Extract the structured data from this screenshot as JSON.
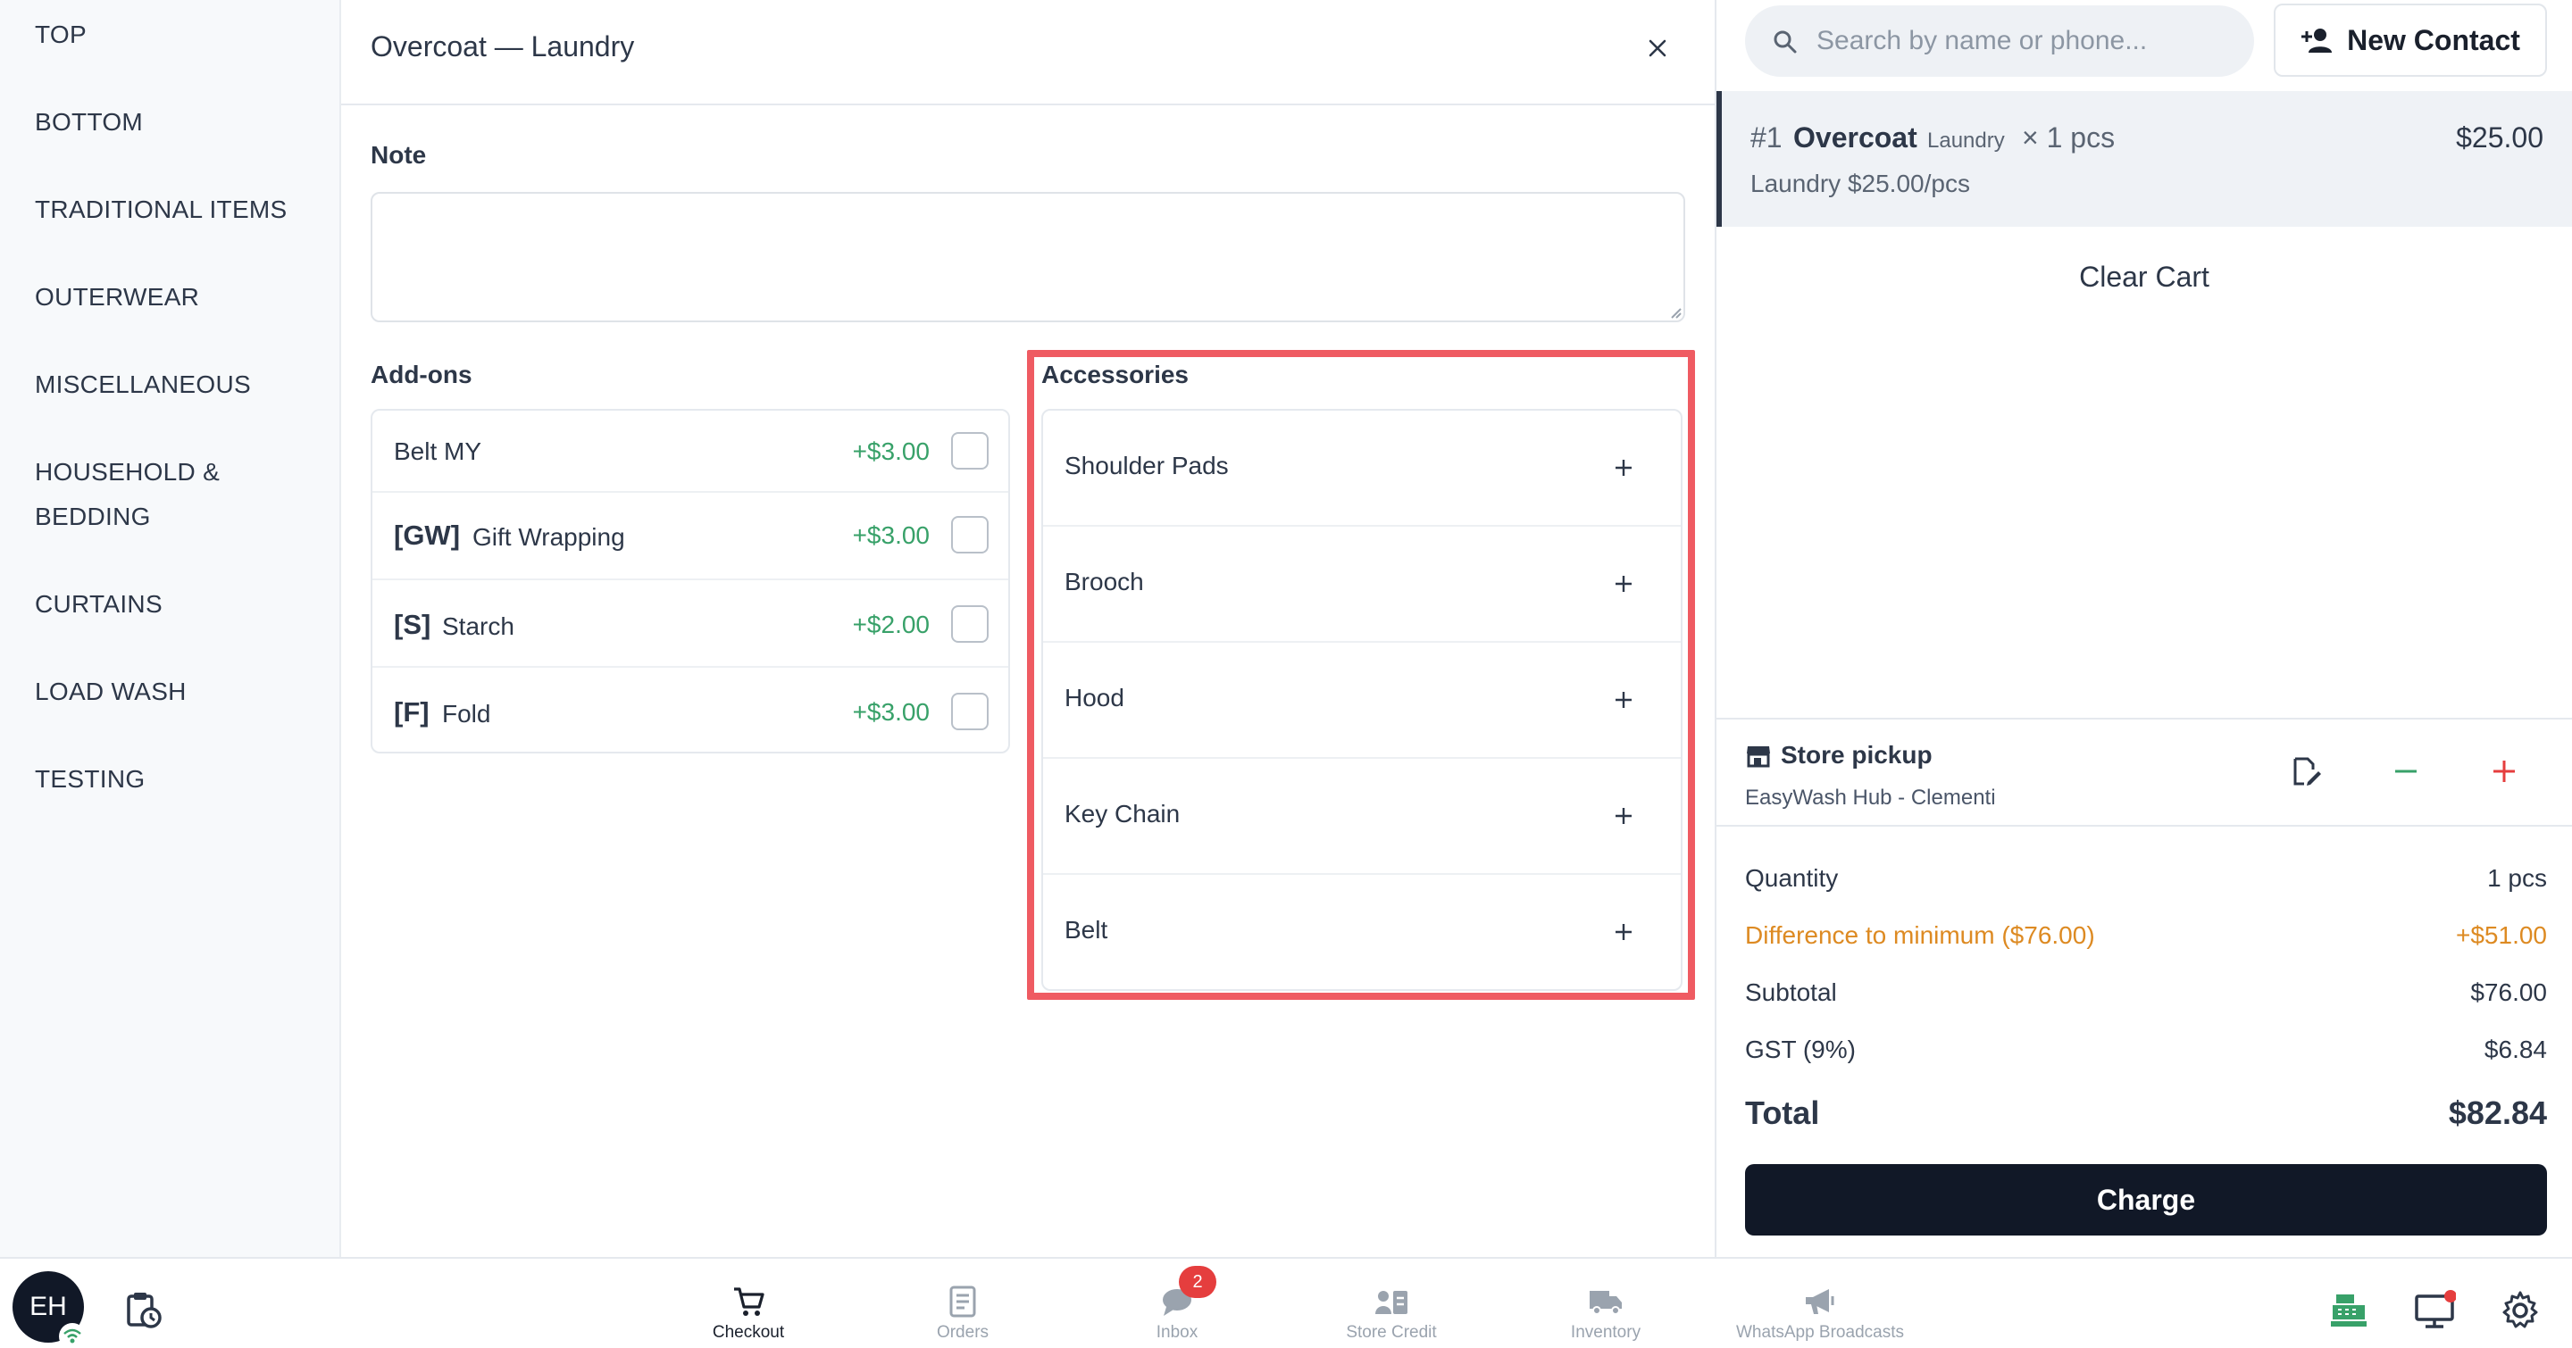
{
  "sidebar": {
    "items": [
      {
        "label": "TOP"
      },
      {
        "label": "BOTTOM"
      },
      {
        "label": "TRADITIONAL ITEMS"
      },
      {
        "label": "OUTERWEAR"
      },
      {
        "label": "MISCELLANEOUS"
      },
      {
        "label": "HOUSEHOLD &"
      },
      {
        "label": "BEDDING"
      },
      {
        "label": "CURTAINS"
      },
      {
        "label": "LOAD WASH"
      },
      {
        "label": "TESTING"
      }
    ]
  },
  "detail": {
    "title": "Overcoat — Laundry",
    "close_icon": "close-icon",
    "note_label": "Note",
    "note_value": "",
    "addons_label": "Add-ons",
    "addons": [
      {
        "code": "",
        "name": "Belt MY",
        "price": "+$3.00",
        "checked": false
      },
      {
        "code": "[GW]",
        "name": "Gift Wrapping",
        "price": "+$3.00",
        "checked": false
      },
      {
        "code": "[S]",
        "name": "Starch",
        "price": "+$2.00",
        "checked": false
      },
      {
        "code": "[F]",
        "name": "Fold",
        "price": "+$3.00",
        "checked": false
      }
    ],
    "accessories_label": "Accessories",
    "accessories": [
      {
        "name": "Shoulder Pads"
      },
      {
        "name": "Brooch"
      },
      {
        "name": "Hood"
      },
      {
        "name": "Key Chain"
      },
      {
        "name": "Belt"
      }
    ]
  },
  "cart": {
    "search_placeholder": "Search by name or phone...",
    "new_contact_label": "New Contact",
    "item": {
      "number": "#1",
      "name": "Overcoat",
      "tag": "Laundry",
      "qty": "× 1 pcs",
      "price": "$25.00",
      "sub": "Laundry $25.00/pcs"
    },
    "clear_cart_label": "Clear Cart",
    "pickup": {
      "title": "Store pickup",
      "location": "EasyWash Hub - Clementi"
    },
    "summary": {
      "quantity_label": "Quantity",
      "quantity_value": "1 pcs",
      "diff_label": "Difference to minimum ($76.00)",
      "diff_value": "+$51.00",
      "subtotal_label": "Subtotal",
      "subtotal_value": "$76.00",
      "gst_label": "GST (9%)",
      "gst_value": "$6.84",
      "total_label": "Total",
      "total_value": "$82.84"
    },
    "charge_label": "Charge"
  },
  "bottom_nav": {
    "avatar_initials": "EH",
    "items": [
      {
        "label": "Checkout",
        "icon": "cart-icon",
        "active": true
      },
      {
        "label": "Orders",
        "icon": "orders-icon",
        "active": false
      },
      {
        "label": "Inbox",
        "icon": "chat-icon",
        "active": false
      },
      {
        "label": "Store Credit",
        "icon": "store-credit-icon",
        "active": false
      },
      {
        "label": "Inventory",
        "icon": "truck-icon",
        "active": false
      },
      {
        "label": "WhatsApp Broadcasts",
        "icon": "megaphone-icon",
        "active": false
      }
    ],
    "inbox_badge": "2"
  },
  "colors": {
    "accent_dark": "#111827",
    "price_green": "#38a169",
    "warning_orange": "#dd8a22",
    "highlight_red": "#ef5b62",
    "plus_red": "#e53e3e",
    "minus_green": "#38a169"
  }
}
